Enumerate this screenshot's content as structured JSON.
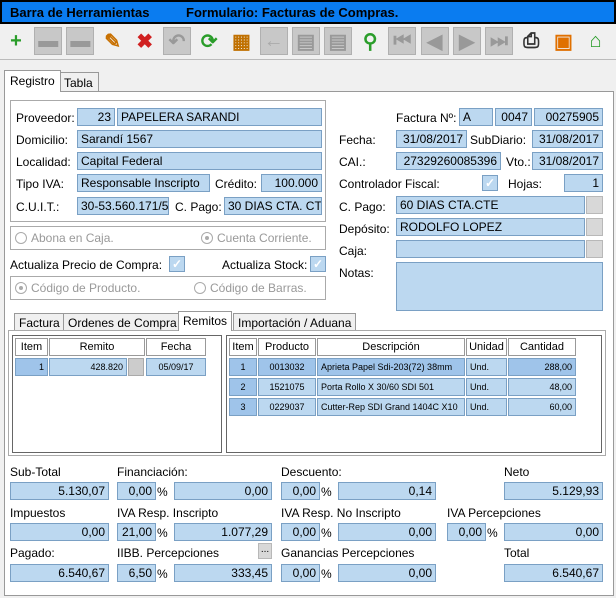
{
  "title": {
    "left": "Barra de Herramientas",
    "right": "Formulario: Facturas de Compras."
  },
  "toolbar": {
    "items": [
      {
        "name": "add-icon",
        "glyph": "+",
        "color": "#2a9d2a",
        "enabled": true
      },
      {
        "name": "save-icon",
        "glyph": "▬",
        "color": "#999",
        "enabled": false
      },
      {
        "name": "save-as-icon",
        "glyph": "▬",
        "color": "#999",
        "enabled": false
      },
      {
        "name": "edit-pencil-icon",
        "glyph": "✎",
        "color": "#c87000",
        "enabled": true
      },
      {
        "name": "delete-save-icon",
        "glyph": "✖",
        "color": "#d02020",
        "enabled": true
      },
      {
        "name": "undo-icon",
        "glyph": "↶",
        "color": "#999",
        "enabled": false
      },
      {
        "name": "refresh-icon",
        "glyph": "⟳",
        "color": "#2a9d2a",
        "enabled": true
      },
      {
        "name": "film-icon",
        "glyph": "▦",
        "color": "#c07000",
        "enabled": true
      },
      {
        "name": "back-arrow-icon",
        "glyph": "←",
        "color": "#aaa",
        "enabled": false
      },
      {
        "name": "grid-icon",
        "glyph": "▤",
        "color": "#999",
        "enabled": false
      },
      {
        "name": "grid2-icon",
        "glyph": "▤",
        "color": "#999",
        "enabled": false
      },
      {
        "name": "search-icon",
        "glyph": "⚲",
        "color": "#2a9d2a",
        "enabled": true
      },
      {
        "name": "first-icon",
        "glyph": "⏮",
        "color": "#999",
        "enabled": false
      },
      {
        "name": "prev-icon",
        "glyph": "◀",
        "color": "#999",
        "enabled": false
      },
      {
        "name": "next-icon",
        "glyph": "▶",
        "color": "#999",
        "enabled": false
      },
      {
        "name": "last-icon",
        "glyph": "⏭",
        "color": "#999",
        "enabled": false
      },
      {
        "name": "print-icon",
        "glyph": "⎙",
        "color": "#333",
        "enabled": true
      },
      {
        "name": "gift-icon",
        "glyph": "▣",
        "color": "#e07000",
        "enabled": true
      },
      {
        "name": "home-icon",
        "glyph": "⌂",
        "color": "#2a9d2a",
        "enabled": true
      }
    ]
  },
  "tabs": [
    "Registro",
    "Tabla"
  ],
  "left": {
    "proveedor_label": "Proveedor:",
    "proveedor_code": "23",
    "proveedor_name": "PAPELERA SARANDI",
    "domicilio_label": "Domicilio:",
    "domicilio": "Sarandí 1567",
    "localidad_label": "Localidad:",
    "localidad": "Capital Federal",
    "tipoiva_label": "Tipo IVA:",
    "tipoiva": "Responsable Inscripto",
    "credito_label": "Crédito:",
    "credito": "100.000",
    "cuit_label": "C.U.I.T.:",
    "cuit": "30-53.560.171/5",
    "cpago_label": "C. Pago:",
    "cpago": "30 DIAS CTA. CTE",
    "abona_caja": "Abona en Caja.",
    "cuenta_corriente": "Cuenta Corriente.",
    "actualiza_precio": "Actualiza Precio de Compra:",
    "actualiza_stock": "Actualiza Stock:",
    "codigo_producto": "Código de Producto.",
    "codigo_barras": "Código de Barras."
  },
  "right": {
    "factura_label": "Factura Nº:",
    "factura_tipo": "A",
    "factura_pv": "0047",
    "factura_num": "00275905",
    "fecha_label": "Fecha:",
    "fecha": "31/08/2017",
    "subdiario_label": "SubDiario:",
    "subdiario": "31/08/2017",
    "cai_label": "CAI.:",
    "cai": "27329260085396",
    "vto_label": "Vto.:",
    "vto": "31/08/2017",
    "controlador_label": "Controlador Fiscal:",
    "hojas_label": "Hojas:",
    "hojas": "1",
    "cpago_label": "C. Pago:",
    "cpago": "60 DIAS CTA.CTE",
    "deposito_label": "Depósito:",
    "deposito": "RODOLFO LOPEZ",
    "caja_label": "Caja:",
    "notas_label": "Notas:"
  },
  "subtabs": [
    "Factura",
    "Ordenes de Compra",
    "Remitos",
    "Importación / Aduana"
  ],
  "remitos": {
    "headers": [
      "Item",
      "Remito",
      "Fecha"
    ],
    "rows": [
      {
        "item": "1",
        "remito": "428.820",
        "fecha": "05/09/17"
      }
    ]
  },
  "productos": {
    "headers": [
      "Item",
      "Producto",
      "Descripción",
      "Unidad",
      "Cantidad"
    ],
    "rows": [
      {
        "item": "1",
        "producto": "0013032",
        "descripcion": "Aprieta Papel Sdi-203(72) 38mm",
        "unidad": "Und.",
        "cantidad": "288,00"
      },
      {
        "item": "2",
        "producto": "1521075",
        "descripcion": "Porta Rollo X 30/60 SDI 501",
        "unidad": "Und.",
        "cantidad": "48,00"
      },
      {
        "item": "3",
        "producto": "0229037",
        "descripcion": "Cutter-Rep SDI Grand 1404C X10",
        "unidad": "Und.",
        "cantidad": "60,00"
      }
    ]
  },
  "totals": {
    "subtotal_label": "Sub-Total",
    "subtotal": "5.130,07",
    "financiacion_label": "Financiación:",
    "financiacion_pct": "0,00",
    "financiacion": "0,00",
    "descuento_label": "Descuento:",
    "descuento_pct": "0,00",
    "descuento": "0,14",
    "neto_label": "Neto",
    "neto": "5.129,93",
    "impuestos_label": "Impuestos",
    "impuestos": "0,00",
    "ivari_label": "IVA Resp. Inscripto",
    "ivari_pct": "21,00",
    "ivari": "1.077,29",
    "ivarni_label": "IVA Resp. No Inscripto",
    "ivarni_pct": "0,00",
    "ivarni": "0,00",
    "ivaperc_label": "IVA Percepciones",
    "ivaperc_pct": "0,00",
    "ivaperc": "0,00",
    "pagado_label": "Pagado:",
    "pagado": "6.540,67",
    "iibb_label": "IIBB. Percepciones",
    "iibb_pct": "6,50",
    "iibb": "333,45",
    "ganancias_label": "Ganancias Percepciones",
    "ganancias_pct": "0,00",
    "ganancias": "0,00",
    "total_label": "Total",
    "total": "6.540,67",
    "pct_sign": "%",
    "ellipsis": "..."
  }
}
